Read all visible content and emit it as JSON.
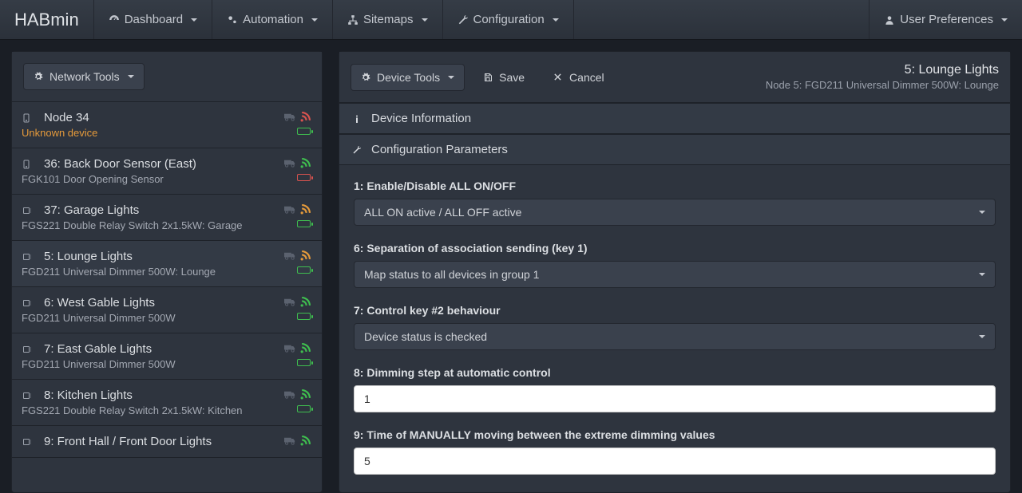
{
  "brand": "HABmin",
  "nav": {
    "dashboard": "Dashboard",
    "automation": "Automation",
    "sitemaps": "Sitemaps",
    "configuration": "Configuration",
    "user_prefs": "User Preferences"
  },
  "sidebar": {
    "network_tools": "Network Tools",
    "nodes": [
      {
        "icon": "📱",
        "title": "Node 34",
        "sub": "Unknown device",
        "sub_warn": true,
        "rss": "red",
        "batt": "green"
      },
      {
        "icon": "📱",
        "title": "36: Back Door Sensor (East)",
        "sub": "FGK101 Door Opening Sensor",
        "rss": "green",
        "batt": "red"
      },
      {
        "icon": "⎚",
        "title": "37: Garage Lights",
        "sub": "FGS221 Double Relay Switch 2x1.5kW: Garage",
        "rss": "orange",
        "batt": "green"
      },
      {
        "icon": "⎚",
        "title": "5: Lounge Lights",
        "sub": "FGD211 Universal Dimmer 500W: Lounge",
        "rss": "orange",
        "batt": "green",
        "active": true
      },
      {
        "icon": "⎚",
        "title": "6: West Gable Lights",
        "sub": "FGD211 Universal Dimmer 500W",
        "rss": "green",
        "batt": "green"
      },
      {
        "icon": "⎚",
        "title": "7: East Gable Lights",
        "sub": "FGD211 Universal Dimmer 500W",
        "rss": "green",
        "batt": "green"
      },
      {
        "icon": "⎚",
        "title": "8: Kitchen Lights",
        "sub": "FGS221 Double Relay Switch 2x1.5kW: Kitchen",
        "rss": "green",
        "batt": "green"
      },
      {
        "icon": "⎚",
        "title": "9: Front Hall / Front Door Lights",
        "sub": "",
        "rss": "green",
        "batt": ""
      }
    ]
  },
  "content": {
    "device_tools": "Device Tools",
    "save": "Save",
    "cancel": "Cancel",
    "title": "5: Lounge Lights",
    "subtitle": "Node 5: FGD211 Universal Dimmer 500W: Lounge",
    "section_info": "Device Information",
    "section_config": "Configuration Parameters",
    "params": [
      {
        "kind": "select",
        "label": "1: Enable/Disable ALL ON/OFF",
        "value": "ALL ON active / ALL OFF active"
      },
      {
        "kind": "select",
        "label": "6: Separation of association sending (key 1)",
        "value": "Map status to all devices in group 1"
      },
      {
        "kind": "select",
        "label": "7: Control key #2 behaviour",
        "value": "Device status is checked"
      },
      {
        "kind": "input",
        "label": "8: Dimming step at automatic control",
        "value": "1"
      },
      {
        "kind": "input",
        "label": "9: Time of MANUALLY moving between the extreme dimming values",
        "value": "5"
      }
    ]
  }
}
